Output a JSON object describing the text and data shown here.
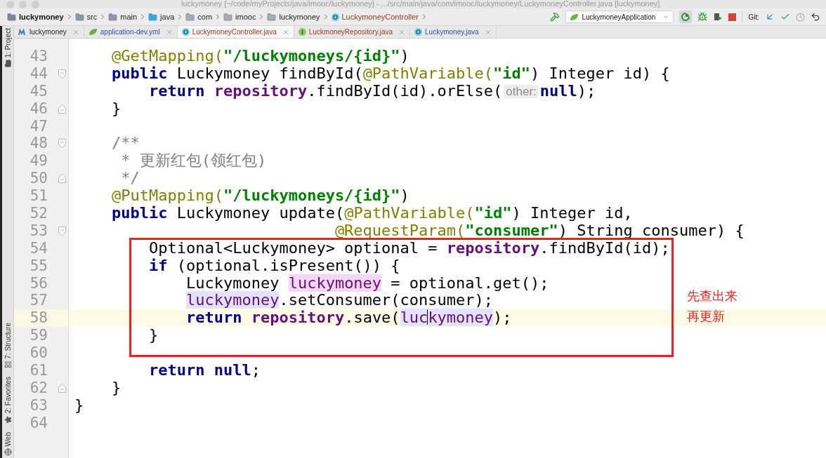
{
  "window": {
    "title": "luckymoney [~/code/myProjects/java/imooc/luckymoney] - .../src/main/java/com/imooc/luckymoney/LuckymoneyController.java [luckymoney]"
  },
  "breadcrumbs": [
    {
      "label": "luckymoney",
      "kind": "project"
    },
    {
      "label": "src",
      "kind": "folder"
    },
    {
      "label": "main",
      "kind": "folder"
    },
    {
      "label": "java",
      "kind": "source"
    },
    {
      "label": "com",
      "kind": "package"
    },
    {
      "label": "imooc",
      "kind": "package"
    },
    {
      "label": "luckymoney",
      "kind": "package"
    },
    {
      "label": "LuckymoneyController",
      "kind": "class"
    }
  ],
  "toolbar": {
    "run_config": "LuckymoneyApplication",
    "git_label": "Git:"
  },
  "tool_windows": [
    {
      "label": "1: Project",
      "kind": "project"
    },
    {
      "label": "7: Structure",
      "kind": "structure"
    },
    {
      "label": "2: Favorites",
      "kind": "favorites"
    },
    {
      "label": "Web",
      "kind": "web"
    }
  ],
  "tabs": [
    {
      "label": "luckymoney",
      "kind": "module",
      "modified": false,
      "unversioned": false,
      "selected": false
    },
    {
      "label": "application-dev.yml",
      "kind": "yml",
      "modified": true,
      "unversioned": false,
      "selected": false
    },
    {
      "label": "LuckymoneyController.java",
      "kind": "class",
      "modified": false,
      "unversioned": true,
      "selected": true
    },
    {
      "label": "LuckmoneyRepository.java",
      "kind": "interface",
      "modified": false,
      "unversioned": true,
      "selected": false
    },
    {
      "label": "Luckymoney.java",
      "kind": "class",
      "modified": true,
      "unversioned": false,
      "selected": false
    }
  ],
  "lines": [
    {
      "number": "43",
      "tokens": [
        {
          "kind": "ann",
          "text": "    @GetMapping("
        },
        {
          "kind": "str",
          "text": "\"/luckymoneys/{id}\""
        },
        {
          "kind": "plain",
          "text": ")"
        }
      ]
    },
    {
      "number": "44",
      "fold_start": true,
      "tokens": [
        {
          "kind": "kw",
          "text": "    public"
        },
        {
          "kind": "plain",
          "text": " Luckymoney findById("
        },
        {
          "kind": "ann",
          "text": "@PathVariable("
        },
        {
          "kind": "str",
          "text": "\"id\""
        },
        {
          "kind": "plain",
          "text": ") Integer id) {"
        }
      ]
    },
    {
      "number": "45",
      "tokens": [
        {
          "kind": "kw",
          "text": "        return"
        },
        {
          "kind": "field",
          "text": " repository"
        },
        {
          "kind": "plain",
          "text": ".findById(id).orElse("
        },
        {
          "kind": "hint",
          "text": "other:"
        },
        {
          "kind": "kw",
          "text": "null"
        },
        {
          "kind": "plain",
          "text": ");"
        }
      ]
    },
    {
      "number": "46",
      "fold_end": true,
      "tokens": [
        {
          "kind": "plain",
          "text": "    }"
        }
      ]
    },
    {
      "number": "47"
    },
    {
      "number": "48",
      "fold_start": true,
      "tokens": [
        {
          "kind": "comment",
          "text": "    /**"
        }
      ]
    },
    {
      "number": "49",
      "tokens": [
        {
          "kind": "comment",
          "text": "     * 更新红包(领红包)"
        }
      ]
    },
    {
      "number": "50",
      "fold_end": true,
      "tokens": [
        {
          "kind": "comment",
          "text": "     */"
        }
      ]
    },
    {
      "number": "51",
      "tokens": [
        {
          "kind": "ann",
          "text": "    @PutMapping("
        },
        {
          "kind": "str",
          "text": "\"/luckymoneys/{id}\""
        },
        {
          "kind": "plain",
          "text": ")"
        }
      ]
    },
    {
      "number": "52",
      "tokens": [
        {
          "kind": "kw",
          "text": "    public"
        },
        {
          "kind": "plain",
          "text": " Luckymoney update("
        },
        {
          "kind": "ann",
          "text": "@PathVariable("
        },
        {
          "kind": "str",
          "text": "\"id\""
        },
        {
          "kind": "plain",
          "text": ") Integer id,"
        }
      ]
    },
    {
      "number": "53",
      "fold_start": true,
      "tokens": [
        {
          "kind": "ann",
          "text": "                            @RequestParam("
        },
        {
          "kind": "str",
          "text": "\"consumer\""
        },
        {
          "kind": "plain",
          "text": ") String consumer) {"
        }
      ]
    },
    {
      "number": "54",
      "tokens": [
        {
          "kind": "plain",
          "text": "        Optional<Luckymoney> optional = "
        },
        {
          "kind": "field",
          "text": "repository"
        },
        {
          "kind": "plain",
          "text": ".findById(id);"
        }
      ]
    },
    {
      "number": "55",
      "tokens": [
        {
          "kind": "kw",
          "text": "        if"
        },
        {
          "kind": "plain",
          "text": " (optional.isPresent()) {"
        }
      ]
    },
    {
      "number": "56",
      "tokens": [
        {
          "kind": "plain",
          "text": "            Luckymoney "
        },
        {
          "kind": "decl",
          "text": "luckymoney"
        },
        {
          "kind": "plain",
          "text": " = optional.get();"
        }
      ]
    },
    {
      "number": "57",
      "tokens": [
        {
          "kind": "usage",
          "text": "            luckymoney"
        },
        {
          "kind": "plain",
          "text": ".setConsumer(consumer);"
        }
      ]
    },
    {
      "number": "58",
      "current": true,
      "tokens": [
        {
          "kind": "kw",
          "text": "            return"
        },
        {
          "kind": "field",
          "text": " repository"
        },
        {
          "kind": "plain",
          "text": ".save("
        },
        {
          "kind": "usage",
          "text": "luc",
          "caret_after": true
        },
        {
          "kind": "usage",
          "text": "kymoney"
        },
        {
          "kind": "plain",
          "text": ");"
        }
      ]
    },
    {
      "number": "59",
      "tokens": [
        {
          "kind": "plain",
          "text": "        }"
        }
      ]
    },
    {
      "number": "60"
    },
    {
      "number": "61",
      "tokens": [
        {
          "kind": "kw",
          "text": "        return"
        },
        {
          "kind": "kw",
          "text": " null"
        },
        {
          "kind": "plain",
          "text": ";"
        }
      ]
    },
    {
      "number": "62",
      "fold_end": true,
      "tokens": [
        {
          "kind": "plain",
          "text": "    }"
        }
      ]
    },
    {
      "number": "63",
      "tokens": [
        {
          "kind": "plain",
          "text": "}"
        }
      ]
    },
    {
      "number": "64"
    }
  ],
  "annotation": {
    "lines": [
      "先查出来",
      "再更新"
    ]
  }
}
